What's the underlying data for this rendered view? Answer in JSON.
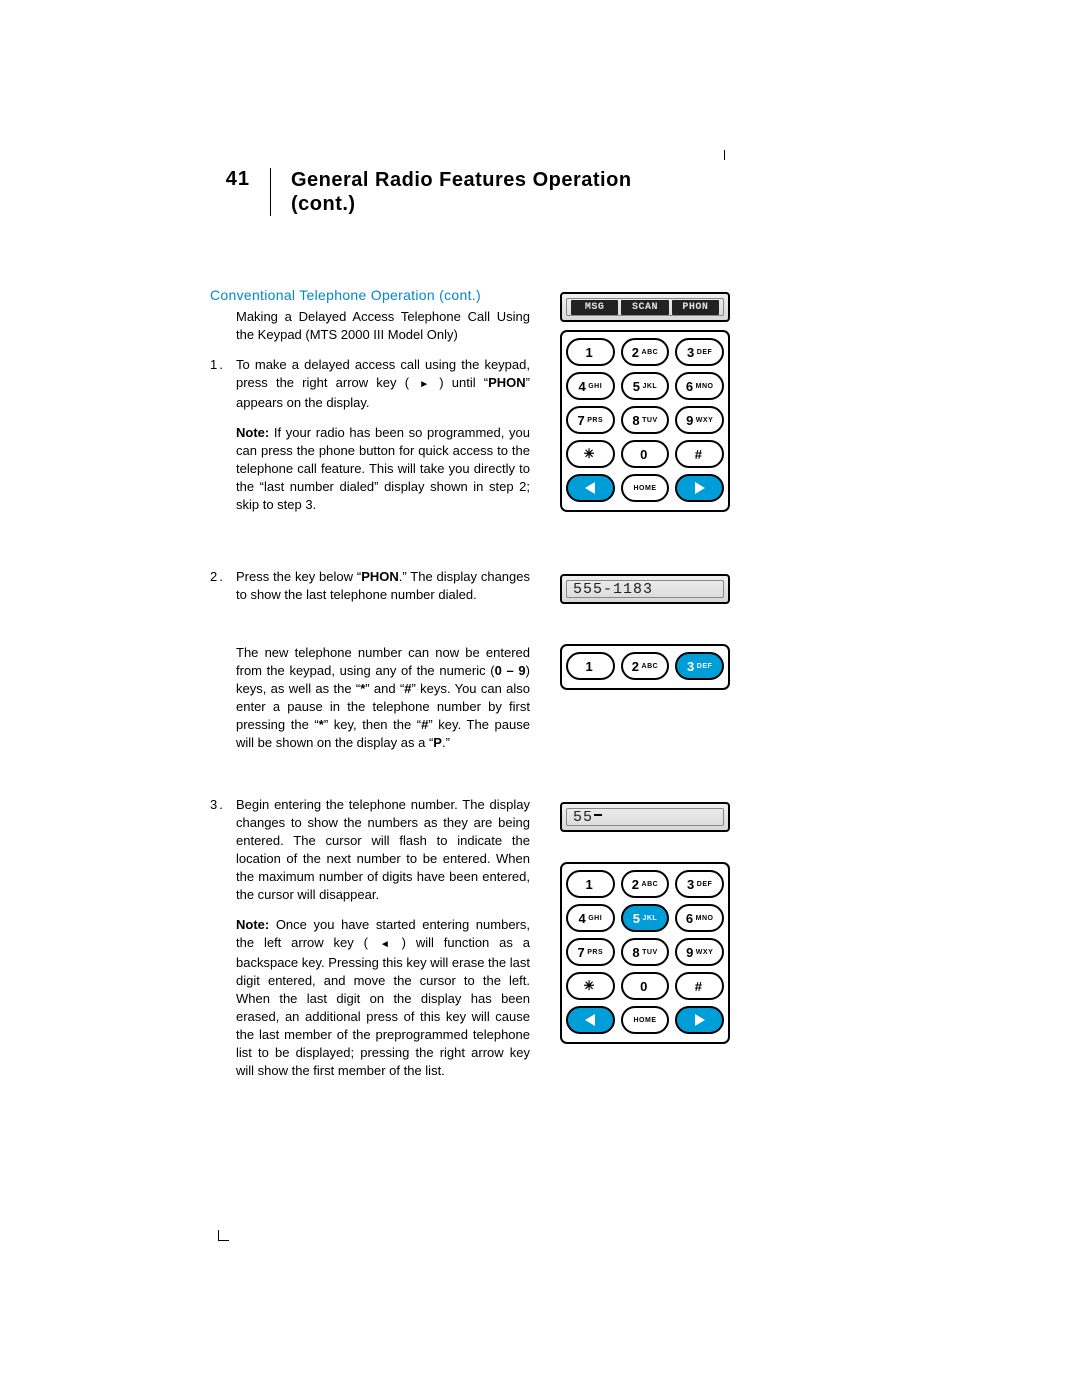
{
  "page_number": "41",
  "title_line1": "General Radio Features Operation",
  "title_line2": "(cont.)",
  "sub_heading": "Conventional Telephone Operation (cont.)",
  "intro": "Making a Delayed Access Telephone Call Using the Keypad (MTS 2000 III Model Only)",
  "step1_num": "1.",
  "step1_a_pre": "To make a delayed access call using the keypad, press the right arrow key ( ",
  "step1_a_post": " ) until “",
  "step1_a_bold": "PHON",
  "step1_a_tail": "” appears on the display.",
  "step1_note_label": "Note:",
  "step1_note_body": " If your radio has been so programmed, you can press the phone button for quick access to the telephone call feature. This will take you directly to the “last number dialed” display shown in step 2; skip to step 3.",
  "step2_num": "2.",
  "step2_a_pre": "Press the key below “",
  "step2_a_bold": "PHON",
  "step2_a_post": ".” The display changes to show the last telephone number dialed.",
  "step2_b_pre": "The new telephone number can now be entered from the keypad, using any of the numeric (",
  "step2_b_bold": "0 – 9",
  "step2_b_mid": ") keys, as well as the “",
  "step2_b_star": "*",
  "step2_b_and": "” and “",
  "step2_b_hash": "#",
  "step2_b_mid2": "” keys. You can also enter a pause in the telephone number by first pressing the “",
  "step2_b_star2": "*",
  "step2_b_then": "” key, then the “",
  "step2_b_hash2": "#",
  "step2_b_tail": "” key. The pause will be shown on the display as a “",
  "step2_b_p": "P",
  "step2_b_end": ".”",
  "step3_num": "3.",
  "step3_a": "Begin entering the telephone number. The display changes to show the numbers as they are being entered. The cursor will flash to indicate the location of the next number to be entered. When the maximum number of digits have been entered, the cursor will disappear.",
  "step3_note_label": "Note:",
  "step3_note_pre": " Once you have started entering numbers, the left arrow key ( ",
  "step3_note_post": " ) will function as a backspace key. Pressing this key will erase the last digit entered, and move the cursor to the left. When the last digit on the display has been erased, an additional press of this key will cause the last member of the preprogrammed telephone list to be displayed; pressing the right arrow key will show the first member of the list.",
  "lcd_tabs": {
    "msg": "MSG",
    "scan": "SCAN",
    "phon": "PHON"
  },
  "lcd2": "555-1183",
  "lcd3": "55",
  "keys": {
    "k1": {
      "big": "1",
      "sm": ""
    },
    "k2": {
      "big": "2",
      "sm": "ABC"
    },
    "k3": {
      "big": "3",
      "sm": "DEF"
    },
    "k4": {
      "big": "4",
      "sm": "GHI"
    },
    "k5": {
      "big": "5",
      "sm": "JKL"
    },
    "k6": {
      "big": "6",
      "sm": "MNO"
    },
    "k7": {
      "big": "7",
      "sm": "PRS"
    },
    "k8": {
      "big": "8",
      "sm": "TUV"
    },
    "k9": {
      "big": "9",
      "sm": "WXY"
    },
    "kstar": {
      "big": "✳",
      "sm": ""
    },
    "k0": {
      "big": "0",
      "sm": ""
    },
    "khash": {
      "big": "#",
      "sm": ""
    },
    "khome": "HOME"
  }
}
